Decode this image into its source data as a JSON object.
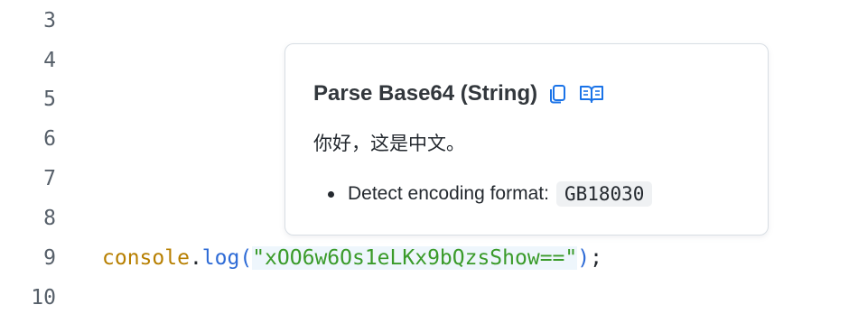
{
  "gutter": {
    "line_numbers": [
      "3",
      "4",
      "5",
      "6",
      "7",
      "8",
      "9",
      "10"
    ]
  },
  "code": {
    "object": "console",
    "dot": ".",
    "method": "log",
    "open_paren": "(",
    "string_literal": "\"xOO6w6Os1eLKx9bQzsShow==\"",
    "close_paren": ")",
    "semicolon": ";"
  },
  "hover": {
    "title": "Parse Base64 (String)",
    "copy_icon": "copy-icon",
    "docs_icon": "book-icon",
    "decoded_text": "你好，这是中文。",
    "detail_label": "Detect encoding format:",
    "detail_value": "GB18030"
  },
  "colors": {
    "object": "#b77f00",
    "method": "#2e6bd6",
    "string": "#3a9b2a",
    "icon": "#1a73e8"
  }
}
